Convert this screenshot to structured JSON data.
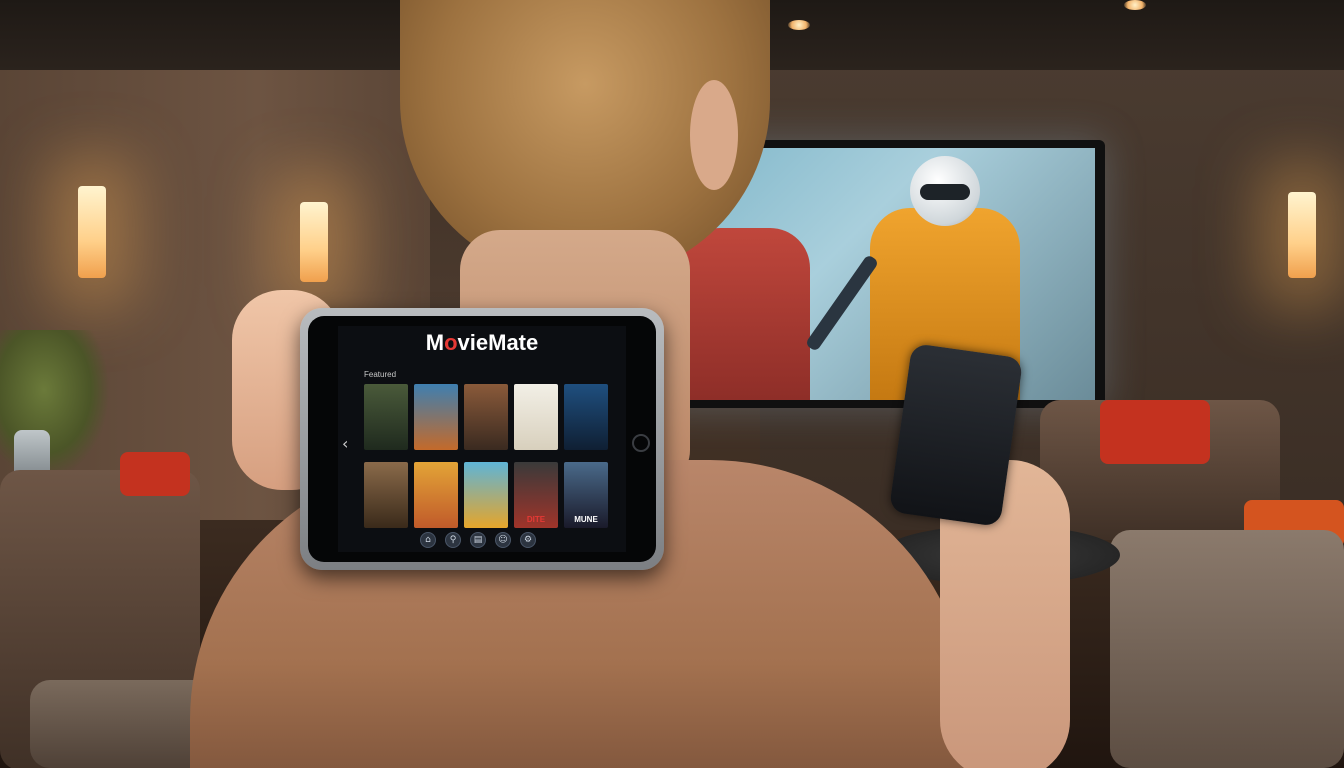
{
  "app": {
    "logo_prefix": "M",
    "logo_o": "o",
    "logo_suffix": "vieMate",
    "section_label": "Featured",
    "back_arrow": "‹"
  },
  "posters": [
    {
      "icon": "poster-1",
      "colors": [
        "#4a5a3a",
        "#1f2a1e"
      ],
      "text": ""
    },
    {
      "icon": "poster-2",
      "colors": [
        "#3f7fb0",
        "#c46a2a"
      ],
      "text": ""
    },
    {
      "icon": "poster-3",
      "colors": [
        "#8a5a3a",
        "#3a2a20"
      ],
      "text": ""
    },
    {
      "icon": "poster-4",
      "colors": [
        "#f2efe6",
        "#d8d0bd"
      ],
      "text": ""
    },
    {
      "icon": "poster-5",
      "colors": [
        "#1f4f7f",
        "#0f1f33"
      ],
      "text": ""
    },
    {
      "icon": "poster-6",
      "colors": [
        "#8a6a4a",
        "#3a2a1a"
      ],
      "text": ""
    },
    {
      "icon": "poster-7",
      "colors": [
        "#e3a437",
        "#c05a2a"
      ],
      "text": ""
    },
    {
      "icon": "poster-8",
      "colors": [
        "#5fb4d6",
        "#e6a52a"
      ],
      "text": ""
    },
    {
      "icon": "poster-9",
      "colors": [
        "#3a3a3a",
        "#a0342a"
      ],
      "text": "DITE"
    },
    {
      "icon": "poster-10",
      "colors": [
        "#4a6a8a",
        "#1a1a2a"
      ],
      "text": "MUNE"
    }
  ],
  "toolbar": [
    {
      "icon": "home-icon",
      "glyph": "⌂"
    },
    {
      "icon": "search-icon",
      "glyph": "⚲"
    },
    {
      "icon": "library-icon",
      "glyph": "▤"
    },
    {
      "icon": "profile-icon",
      "glyph": "☺"
    },
    {
      "icon": "settings-icon",
      "glyph": "⚙"
    }
  ]
}
